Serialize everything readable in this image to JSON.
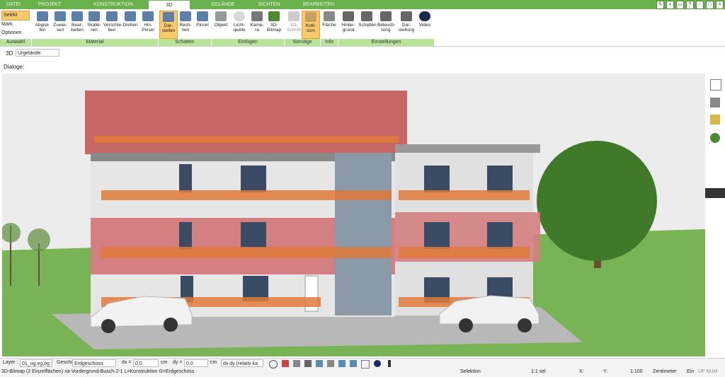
{
  "tabs": [
    "DATEI",
    "PROJEKT",
    "KONSTRUKTION",
    "3D",
    "GELÄNDE",
    "SICHTEN",
    "BEARBEITEN"
  ],
  "select_column": {
    "selekt": "Selekt",
    "mark": "Mark.",
    "options": "Optionen"
  },
  "groups": [
    "Auswahl",
    "Material",
    "Schatten",
    "Einfügen",
    "Sonstige",
    "Info",
    "Einstellungen"
  ],
  "ribbon_buttons": [
    {
      "label": "Abgrei-\nfen"
    },
    {
      "label": "Zuwei-\nsen"
    },
    {
      "label": "Bear-\nbeiten"
    },
    {
      "label": "Skalie-\nren"
    },
    {
      "label": "Verschie-\nben"
    },
    {
      "label": "Drehen"
    },
    {
      "label": "Hin.\nPinsel"
    },
    {
      "label": "Dar-\nstellen"
    },
    {
      "label": "Rech-\nnen"
    },
    {
      "label": "Pinsel"
    },
    {
      "label": "Objekt"
    },
    {
      "label": "Licht-\nquelle"
    },
    {
      "label": "Kame-\nra"
    },
    {
      "label": "3D-\nBitmap"
    },
    {
      "label": "3D-\nSchnitt"
    },
    {
      "label": "Kolli-\nsion"
    },
    {
      "label": "Fläche"
    },
    {
      "label": "Hinter-\ngrund"
    },
    {
      "label": "Schatten"
    },
    {
      "label": "Beleuch-\ntung"
    },
    {
      "label": "Dar-\nstellung"
    },
    {
      "label": "Video"
    }
  ],
  "view": {
    "mode": "3D",
    "terrain": "Urgelände"
  },
  "dialog_label": "Dialoge:",
  "statusbar": {
    "layer_label": "Layer :",
    "layer_value": "01_ug,eg,og",
    "floor_label": "Geschoss :",
    "floor_value": "Erdgeschoss",
    "dx_label": "dx =",
    "dx_value": "0,0",
    "dy_label": "dy =",
    "dy_value": "0,0",
    "unit": "cm",
    "coord_mode": "dx,dy (relativ ka"
  },
  "info": {
    "object": "3D-Bitmap (2 Einzelflächen) xa-Vordergrund-Busch-2-1 L=Konstruktion G=Erdgeschoss",
    "mode": "Selektion",
    "sel": "1:1 sel",
    "x": "X:",
    "y": "Y:",
    "scale": "1:100",
    "unit": "Zentimeter",
    "on": "Ein",
    "flags": "UF NUM"
  },
  "colors": {
    "accent": "#6ab04c",
    "group": "#b9e39a",
    "active": "#f9c96a"
  }
}
